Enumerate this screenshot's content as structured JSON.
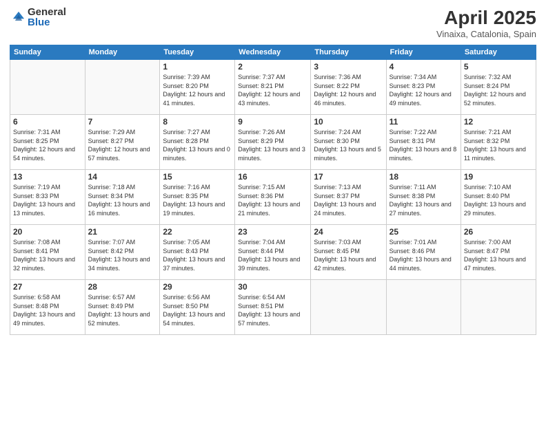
{
  "header": {
    "logo_general": "General",
    "logo_blue": "Blue",
    "title": "April 2025",
    "location": "Vinaixa, Catalonia, Spain"
  },
  "weekdays": [
    "Sunday",
    "Monday",
    "Tuesday",
    "Wednesday",
    "Thursday",
    "Friday",
    "Saturday"
  ],
  "weeks": [
    [
      {
        "day": "",
        "empty": true
      },
      {
        "day": "",
        "empty": true
      },
      {
        "day": "1",
        "sunrise": "Sunrise: 7:39 AM",
        "sunset": "Sunset: 8:20 PM",
        "daylight": "Daylight: 12 hours and 41 minutes."
      },
      {
        "day": "2",
        "sunrise": "Sunrise: 7:37 AM",
        "sunset": "Sunset: 8:21 PM",
        "daylight": "Daylight: 12 hours and 43 minutes."
      },
      {
        "day": "3",
        "sunrise": "Sunrise: 7:36 AM",
        "sunset": "Sunset: 8:22 PM",
        "daylight": "Daylight: 12 hours and 46 minutes."
      },
      {
        "day": "4",
        "sunrise": "Sunrise: 7:34 AM",
        "sunset": "Sunset: 8:23 PM",
        "daylight": "Daylight: 12 hours and 49 minutes."
      },
      {
        "day": "5",
        "sunrise": "Sunrise: 7:32 AM",
        "sunset": "Sunset: 8:24 PM",
        "daylight": "Daylight: 12 hours and 52 minutes."
      }
    ],
    [
      {
        "day": "6",
        "sunrise": "Sunrise: 7:31 AM",
        "sunset": "Sunset: 8:25 PM",
        "daylight": "Daylight: 12 hours and 54 minutes."
      },
      {
        "day": "7",
        "sunrise": "Sunrise: 7:29 AM",
        "sunset": "Sunset: 8:27 PM",
        "daylight": "Daylight: 12 hours and 57 minutes."
      },
      {
        "day": "8",
        "sunrise": "Sunrise: 7:27 AM",
        "sunset": "Sunset: 8:28 PM",
        "daylight": "Daylight: 13 hours and 0 minutes."
      },
      {
        "day": "9",
        "sunrise": "Sunrise: 7:26 AM",
        "sunset": "Sunset: 8:29 PM",
        "daylight": "Daylight: 13 hours and 3 minutes."
      },
      {
        "day": "10",
        "sunrise": "Sunrise: 7:24 AM",
        "sunset": "Sunset: 8:30 PM",
        "daylight": "Daylight: 13 hours and 5 minutes."
      },
      {
        "day": "11",
        "sunrise": "Sunrise: 7:22 AM",
        "sunset": "Sunset: 8:31 PM",
        "daylight": "Daylight: 13 hours and 8 minutes."
      },
      {
        "day": "12",
        "sunrise": "Sunrise: 7:21 AM",
        "sunset": "Sunset: 8:32 PM",
        "daylight": "Daylight: 13 hours and 11 minutes."
      }
    ],
    [
      {
        "day": "13",
        "sunrise": "Sunrise: 7:19 AM",
        "sunset": "Sunset: 8:33 PM",
        "daylight": "Daylight: 13 hours and 13 minutes."
      },
      {
        "day": "14",
        "sunrise": "Sunrise: 7:18 AM",
        "sunset": "Sunset: 8:34 PM",
        "daylight": "Daylight: 13 hours and 16 minutes."
      },
      {
        "day": "15",
        "sunrise": "Sunrise: 7:16 AM",
        "sunset": "Sunset: 8:35 PM",
        "daylight": "Daylight: 13 hours and 19 minutes."
      },
      {
        "day": "16",
        "sunrise": "Sunrise: 7:15 AM",
        "sunset": "Sunset: 8:36 PM",
        "daylight": "Daylight: 13 hours and 21 minutes."
      },
      {
        "day": "17",
        "sunrise": "Sunrise: 7:13 AM",
        "sunset": "Sunset: 8:37 PM",
        "daylight": "Daylight: 13 hours and 24 minutes."
      },
      {
        "day": "18",
        "sunrise": "Sunrise: 7:11 AM",
        "sunset": "Sunset: 8:38 PM",
        "daylight": "Daylight: 13 hours and 27 minutes."
      },
      {
        "day": "19",
        "sunrise": "Sunrise: 7:10 AM",
        "sunset": "Sunset: 8:40 PM",
        "daylight": "Daylight: 13 hours and 29 minutes."
      }
    ],
    [
      {
        "day": "20",
        "sunrise": "Sunrise: 7:08 AM",
        "sunset": "Sunset: 8:41 PM",
        "daylight": "Daylight: 13 hours and 32 minutes."
      },
      {
        "day": "21",
        "sunrise": "Sunrise: 7:07 AM",
        "sunset": "Sunset: 8:42 PM",
        "daylight": "Daylight: 13 hours and 34 minutes."
      },
      {
        "day": "22",
        "sunrise": "Sunrise: 7:05 AM",
        "sunset": "Sunset: 8:43 PM",
        "daylight": "Daylight: 13 hours and 37 minutes."
      },
      {
        "day": "23",
        "sunrise": "Sunrise: 7:04 AM",
        "sunset": "Sunset: 8:44 PM",
        "daylight": "Daylight: 13 hours and 39 minutes."
      },
      {
        "day": "24",
        "sunrise": "Sunrise: 7:03 AM",
        "sunset": "Sunset: 8:45 PM",
        "daylight": "Daylight: 13 hours and 42 minutes."
      },
      {
        "day": "25",
        "sunrise": "Sunrise: 7:01 AM",
        "sunset": "Sunset: 8:46 PM",
        "daylight": "Daylight: 13 hours and 44 minutes."
      },
      {
        "day": "26",
        "sunrise": "Sunrise: 7:00 AM",
        "sunset": "Sunset: 8:47 PM",
        "daylight": "Daylight: 13 hours and 47 minutes."
      }
    ],
    [
      {
        "day": "27",
        "sunrise": "Sunrise: 6:58 AM",
        "sunset": "Sunset: 8:48 PM",
        "daylight": "Daylight: 13 hours and 49 minutes."
      },
      {
        "day": "28",
        "sunrise": "Sunrise: 6:57 AM",
        "sunset": "Sunset: 8:49 PM",
        "daylight": "Daylight: 13 hours and 52 minutes."
      },
      {
        "day": "29",
        "sunrise": "Sunrise: 6:56 AM",
        "sunset": "Sunset: 8:50 PM",
        "daylight": "Daylight: 13 hours and 54 minutes."
      },
      {
        "day": "30",
        "sunrise": "Sunrise: 6:54 AM",
        "sunset": "Sunset: 8:51 PM",
        "daylight": "Daylight: 13 hours and 57 minutes."
      },
      {
        "day": "",
        "empty": true
      },
      {
        "day": "",
        "empty": true
      },
      {
        "day": "",
        "empty": true
      }
    ]
  ]
}
